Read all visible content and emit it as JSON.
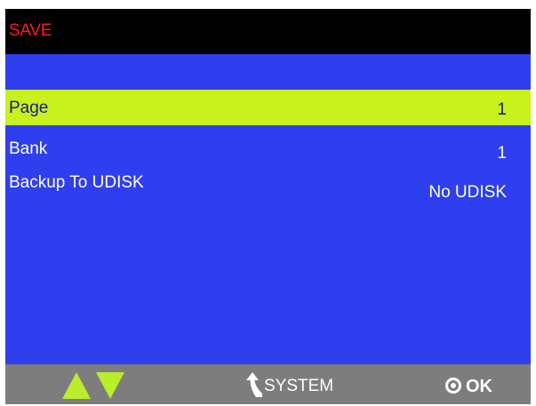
{
  "header": {
    "title": "SAVE"
  },
  "menu": {
    "items": [
      {
        "label": "Page",
        "value": "1",
        "selected": true
      },
      {
        "label": "Bank",
        "value": "1",
        "selected": false
      },
      {
        "label": "Backup To UDISK",
        "value": "No UDISK",
        "selected": false
      }
    ]
  },
  "footer": {
    "up_icon": "triangle-up",
    "down_icon": "triangle-down",
    "back_icon": "return-arrow",
    "system_label": "SYSTEM",
    "ok_icon": "circle-dot",
    "ok_label": "OK"
  },
  "colors": {
    "screen_bg": "#2f3ff0",
    "title_bar_bg": "#000000",
    "title_text": "#ff1a1a",
    "selected_row_bg": "#c9f21c",
    "selected_row_text": "#1a1a8a",
    "footer_bg": "#7d7d7d",
    "arrow_green": "#b8ee2a"
  }
}
